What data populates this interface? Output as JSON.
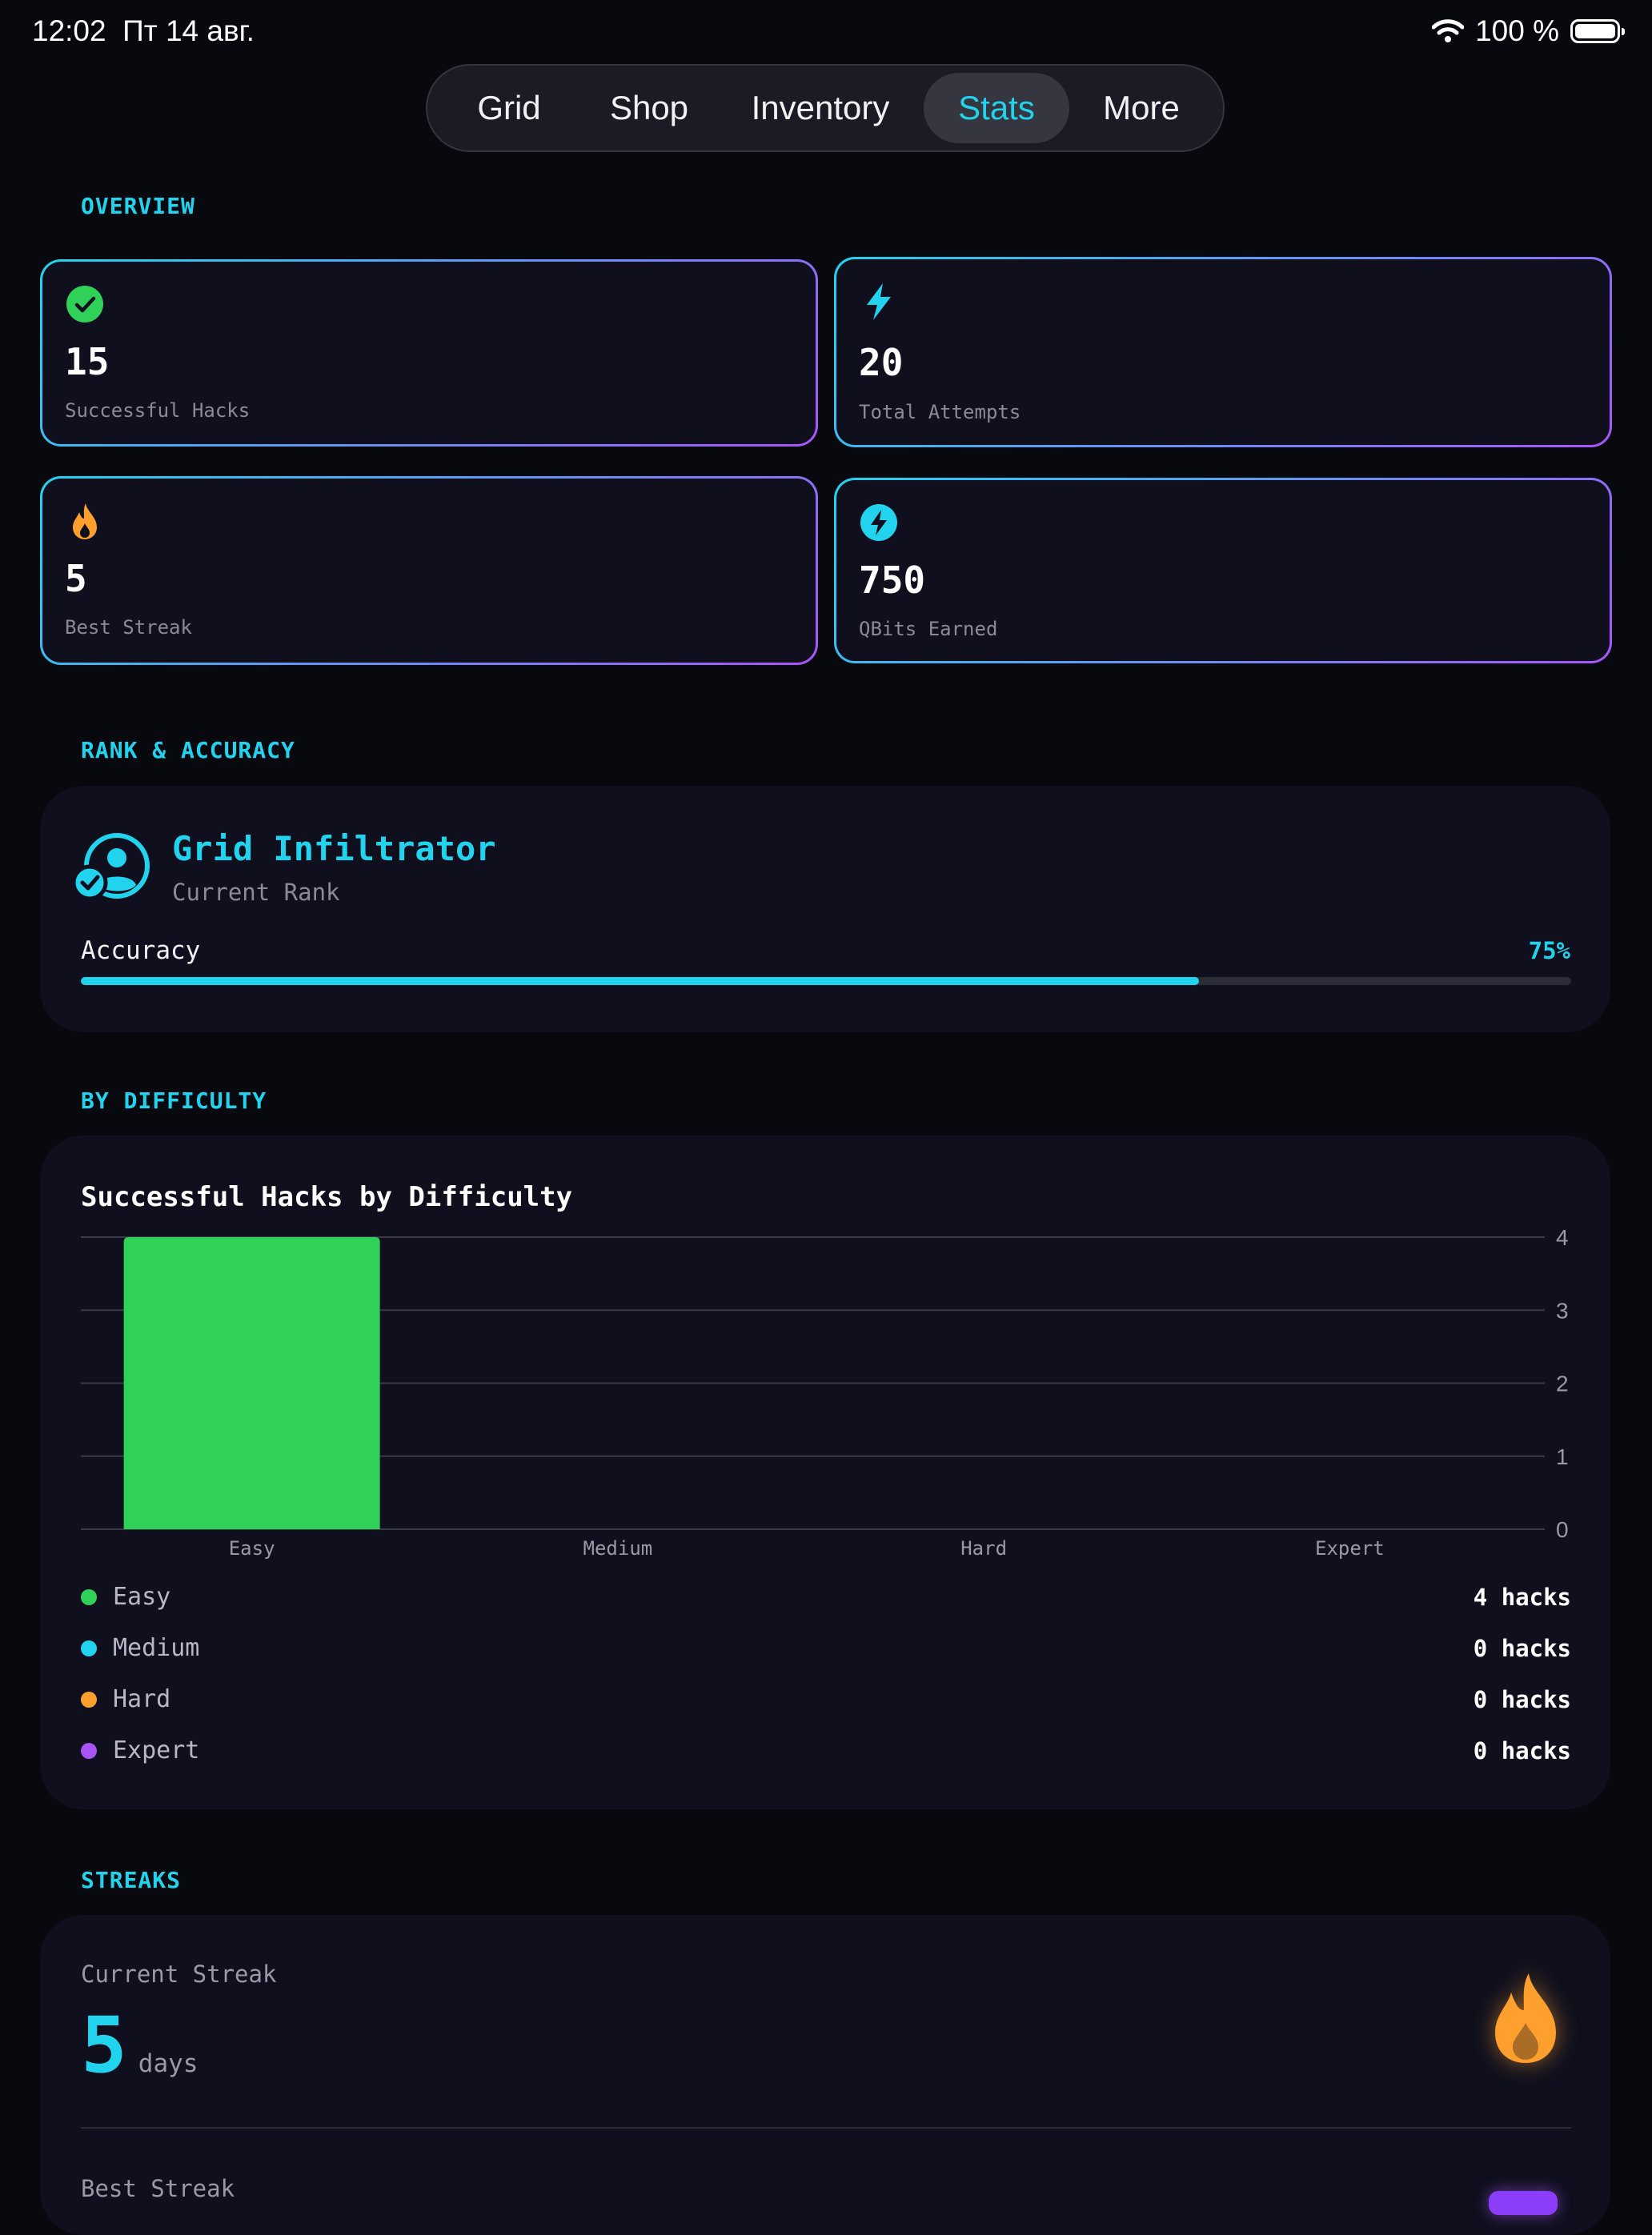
{
  "status_bar": {
    "time": "12:02",
    "date": "Пт 14 авг.",
    "battery": "100 %"
  },
  "tabs": [
    {
      "label": "Grid",
      "active": false
    },
    {
      "label": "Shop",
      "active": false
    },
    {
      "label": "Inventory",
      "active": false
    },
    {
      "label": "Stats",
      "active": true
    },
    {
      "label": "More",
      "active": false
    }
  ],
  "overview": {
    "title": "OVERVIEW",
    "cards": [
      {
        "icon": "checkmark-circle-icon",
        "value": "15",
        "label": "Successful Hacks",
        "color": "#30d158"
      },
      {
        "icon": "lightning-bolt-icon",
        "value": "20",
        "label": "Total Attempts",
        "color": "#22d3ee"
      },
      {
        "icon": "flame-icon",
        "value": "5",
        "label": "Best Streak",
        "color": "#ff9f2e"
      },
      {
        "icon": "bolt-circle-icon",
        "value": "750",
        "label": "QBits Earned",
        "color": "#22d3ee"
      }
    ]
  },
  "rank": {
    "title": "RANK & ACCURACY",
    "icon": "person-badge-check-icon",
    "rank_name": "Grid Infiltrator",
    "rank_caption": "Current Rank",
    "accuracy_label": "Accuracy",
    "accuracy_text": "75%",
    "accuracy_value": 0.75
  },
  "difficulty": {
    "title": "BY DIFFICULTY",
    "chart_title": "Successful Hacks by Difficulty",
    "legend": [
      {
        "name": "Easy",
        "value_text": "4 hacks",
        "color": "#30d158"
      },
      {
        "name": "Medium",
        "value_text": "0 hacks",
        "color": "#22d3ee"
      },
      {
        "name": "Hard",
        "value_text": "0 hacks",
        "color": "#ff9f2e"
      },
      {
        "name": "Expert",
        "value_text": "0 hacks",
        "color": "#a855f7"
      }
    ]
  },
  "chart_data": {
    "type": "bar",
    "title": "Successful Hacks by Difficulty",
    "categories": [
      "Easy",
      "Medium",
      "Hard",
      "Expert"
    ],
    "values": [
      4,
      0,
      0,
      0
    ],
    "colors": [
      "#30d158",
      "#22d3ee",
      "#ff9f2e",
      "#a855f7"
    ],
    "yticks": [
      "0",
      "1",
      "2",
      "3",
      "4"
    ],
    "ylim": [
      0,
      4
    ],
    "grid": true,
    "y_axis_side": "right"
  },
  "streaks": {
    "title": "STREAKS",
    "current_label": "Current Streak",
    "current_value": "5",
    "current_unit": "days",
    "best_label": "Best Streak",
    "icon": "flame-icon"
  }
}
